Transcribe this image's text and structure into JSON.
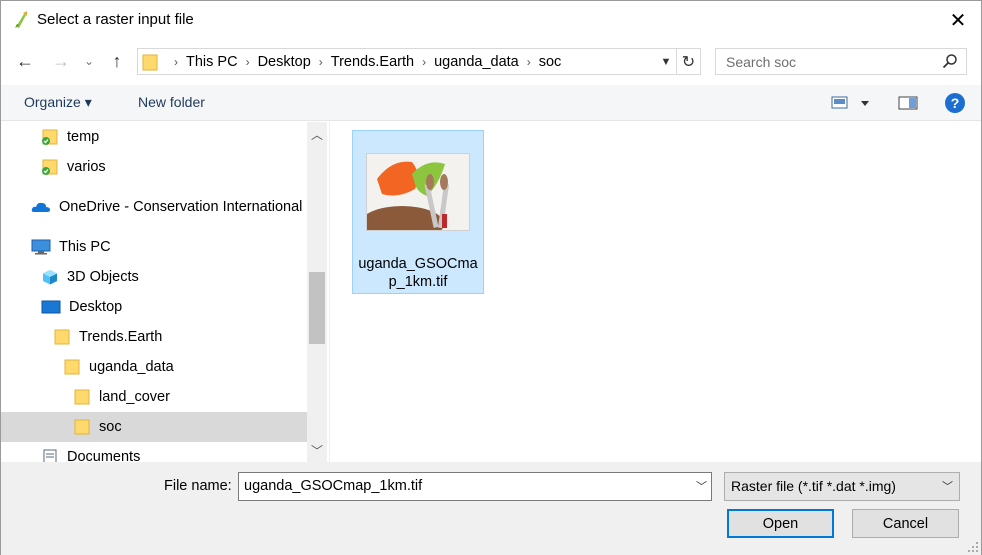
{
  "window": {
    "title": "Select a raster input file",
    "close_glyph": "✕"
  },
  "nav": {
    "back_glyph": "←",
    "forward_glyph": "→",
    "recent_glyph": "⌄",
    "up_glyph": "↑",
    "breadcrumbs": [
      "This PC",
      "Desktop",
      "Trends.Earth",
      "uganda_data",
      "soc"
    ],
    "refresh_glyph": "↻",
    "search_placeholder": "Search soc"
  },
  "toolbar": {
    "organize_label": "Organize ▾",
    "new_folder_label": "New folder",
    "help_glyph": "?"
  },
  "navpane": {
    "items": [
      {
        "label": "temp",
        "icon": "folder-sync-icon"
      },
      {
        "label": "varios",
        "icon": "folder-sync-icon"
      },
      {
        "label": "OneDrive - Conservation International",
        "icon": "onedrive-cloud-icon"
      },
      {
        "label": "This PC",
        "icon": "computer-icon"
      },
      {
        "label": "3D Objects",
        "icon": "3d-objects-icon"
      },
      {
        "label": "Desktop",
        "icon": "desktop-icon"
      },
      {
        "label": "Trends.Earth",
        "icon": "folder-icon"
      },
      {
        "label": "uganda_data",
        "icon": "folder-icon"
      },
      {
        "label": "land_cover",
        "icon": "folder-icon"
      },
      {
        "label": "soc",
        "icon": "folder-icon",
        "selected": true
      },
      {
        "label": "Documents",
        "icon": "documents-icon"
      }
    ]
  },
  "content": {
    "files": [
      {
        "name": "uganda_GSOCmap_1km.tif",
        "icon": "raster-image-thumbnail"
      }
    ]
  },
  "bottom": {
    "file_name_label": "File name:",
    "file_name_value": "uganda_GSOCmap_1km.tif",
    "filter_value": "Raster file (*.tif *.dat *.img)",
    "open_label": "Open",
    "cancel_label": "Cancel"
  },
  "colors": {
    "accent": "#0078d7",
    "selection": "#cce8ff",
    "folder": "#ffd96b"
  }
}
